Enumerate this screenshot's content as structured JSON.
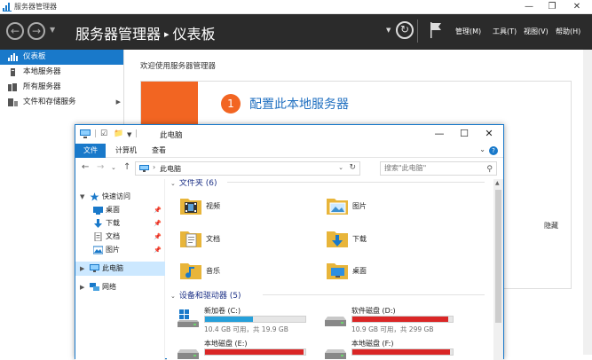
{
  "server_manager": {
    "window_title": "服务器管理器",
    "breadcrumb_root": "服务器管理器",
    "breadcrumb_sep": "▸",
    "breadcrumb_current": "仪表板",
    "menus": [
      "管理(M)",
      "工具(T)",
      "视图(V)",
      "帮助(H)"
    ],
    "sidebar": [
      {
        "label": "仪表板",
        "active": true,
        "icon": "dashboard-icon"
      },
      {
        "label": "本地服务器",
        "active": false,
        "icon": "server-icon"
      },
      {
        "label": "所有服务器",
        "active": false,
        "icon": "servers-icon"
      },
      {
        "label": "文件和存储服务",
        "active": false,
        "icon": "storage-icon",
        "has_children": true
      }
    ],
    "welcome": "欢迎使用服务器管理器",
    "step_number": "1",
    "step_label": "配置此本地服务器",
    "hide_label": "隐藏",
    "accent_color": "#f26522"
  },
  "explorer": {
    "title": "此电脑",
    "ribbon_tabs": [
      "文件",
      "计算机",
      "查看"
    ],
    "address": "此电脑",
    "search_placeholder": "搜索\"此电脑\"",
    "nav": {
      "quick_access": "快速访问",
      "quick_items": [
        {
          "label": "桌面",
          "icon": "desktop-icon"
        },
        {
          "label": "下载",
          "icon": "download-icon"
        },
        {
          "label": "文档",
          "icon": "document-icon"
        },
        {
          "label": "图片",
          "icon": "picture-icon"
        }
      ],
      "this_pc": "此电脑",
      "network": "网络"
    },
    "folders_header": "文件夹 (6)",
    "folders": [
      {
        "label": "视频",
        "icon": "video-folder-icon"
      },
      {
        "label": "图片",
        "icon": "picture-folder-icon"
      },
      {
        "label": "文档",
        "icon": "document-folder-icon"
      },
      {
        "label": "下载",
        "icon": "download-folder-icon"
      },
      {
        "label": "音乐",
        "icon": "music-folder-icon"
      },
      {
        "label": "桌面",
        "icon": "desktop-folder-icon"
      }
    ],
    "drives_header": "设备和驱动器 (5)",
    "drives": [
      {
        "name": "新加卷 (C:)",
        "stats": "10.4 GB 可用，共 19.9 GB",
        "used_fraction": 0.48,
        "color": "#26a0da",
        "icon": "windows-drive-icon"
      },
      {
        "name": "软件磁盘 (D:)",
        "stats": "10.9 GB 可用，共 299 GB",
        "used_fraction": 0.96,
        "color": "#da2626",
        "icon": "drive-icon"
      },
      {
        "name": "本地磁盘 (E:)",
        "stats": "",
        "used_fraction": 0.98,
        "color": "#da2626",
        "icon": "drive-icon"
      },
      {
        "name": "本地磁盘 (F:)",
        "stats": "",
        "used_fraction": 0.97,
        "color": "#da2626",
        "icon": "drive-icon"
      }
    ]
  }
}
